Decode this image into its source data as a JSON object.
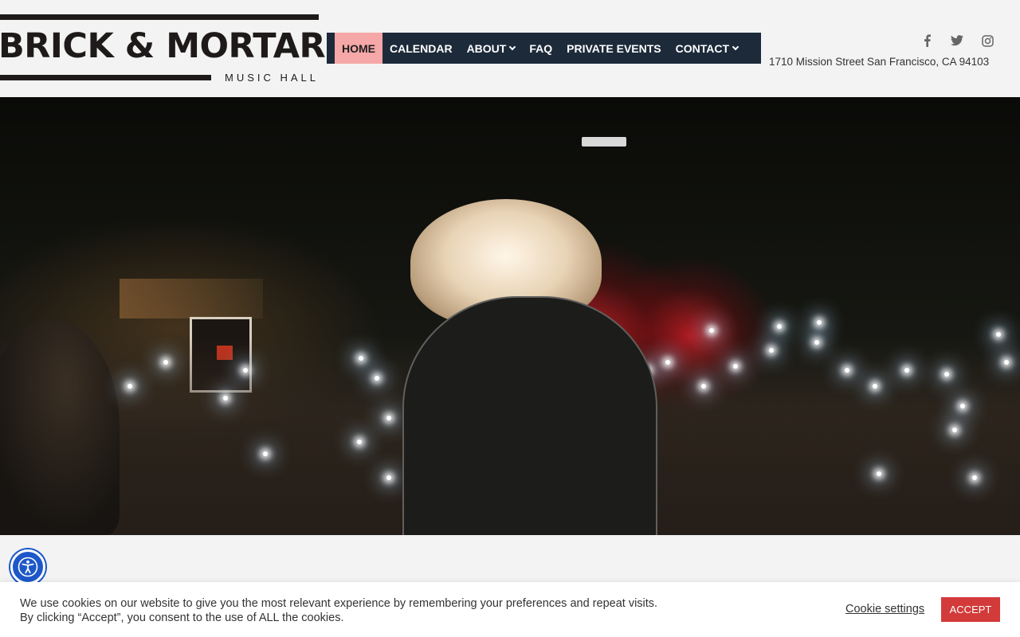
{
  "header": {
    "logo": {
      "wordmark": "BRICK & MORTAR",
      "subtitle": "MUSIC  HALL"
    },
    "nav": [
      {
        "label": "HOME",
        "active": true,
        "dropdown": false
      },
      {
        "label": "CALENDAR",
        "active": false,
        "dropdown": false
      },
      {
        "label": "ABOUT",
        "active": false,
        "dropdown": true
      },
      {
        "label": "FAQ",
        "active": false,
        "dropdown": false
      },
      {
        "label": "PRIVATE EVENTS",
        "active": false,
        "dropdown": false
      },
      {
        "label": "CONTACT",
        "active": false,
        "dropdown": true
      }
    ],
    "social": [
      "facebook-icon",
      "twitter-icon",
      "instagram-icon"
    ],
    "address": "1710 Mission Street San Francisco, CA 94103"
  },
  "hero": {
    "image": "concert-crowd-with-phone-lights"
  },
  "accessibility": {
    "icon": "accessibility-icon"
  },
  "cookie": {
    "line1": "We use cookies on our website to give you the most relevant experience by remembering your preferences and repeat visits.",
    "line2": "By clicking “Accept”, you consent to the use of ALL the cookies.",
    "settings_label": "Cookie settings",
    "accept_label": "ACCEPT"
  },
  "colors": {
    "nav_bg": "#1d2a3a",
    "nav_active_bg": "#f6a7a7",
    "accept_bg": "#d33a3a",
    "a11y_bg": "#1e58c8"
  }
}
